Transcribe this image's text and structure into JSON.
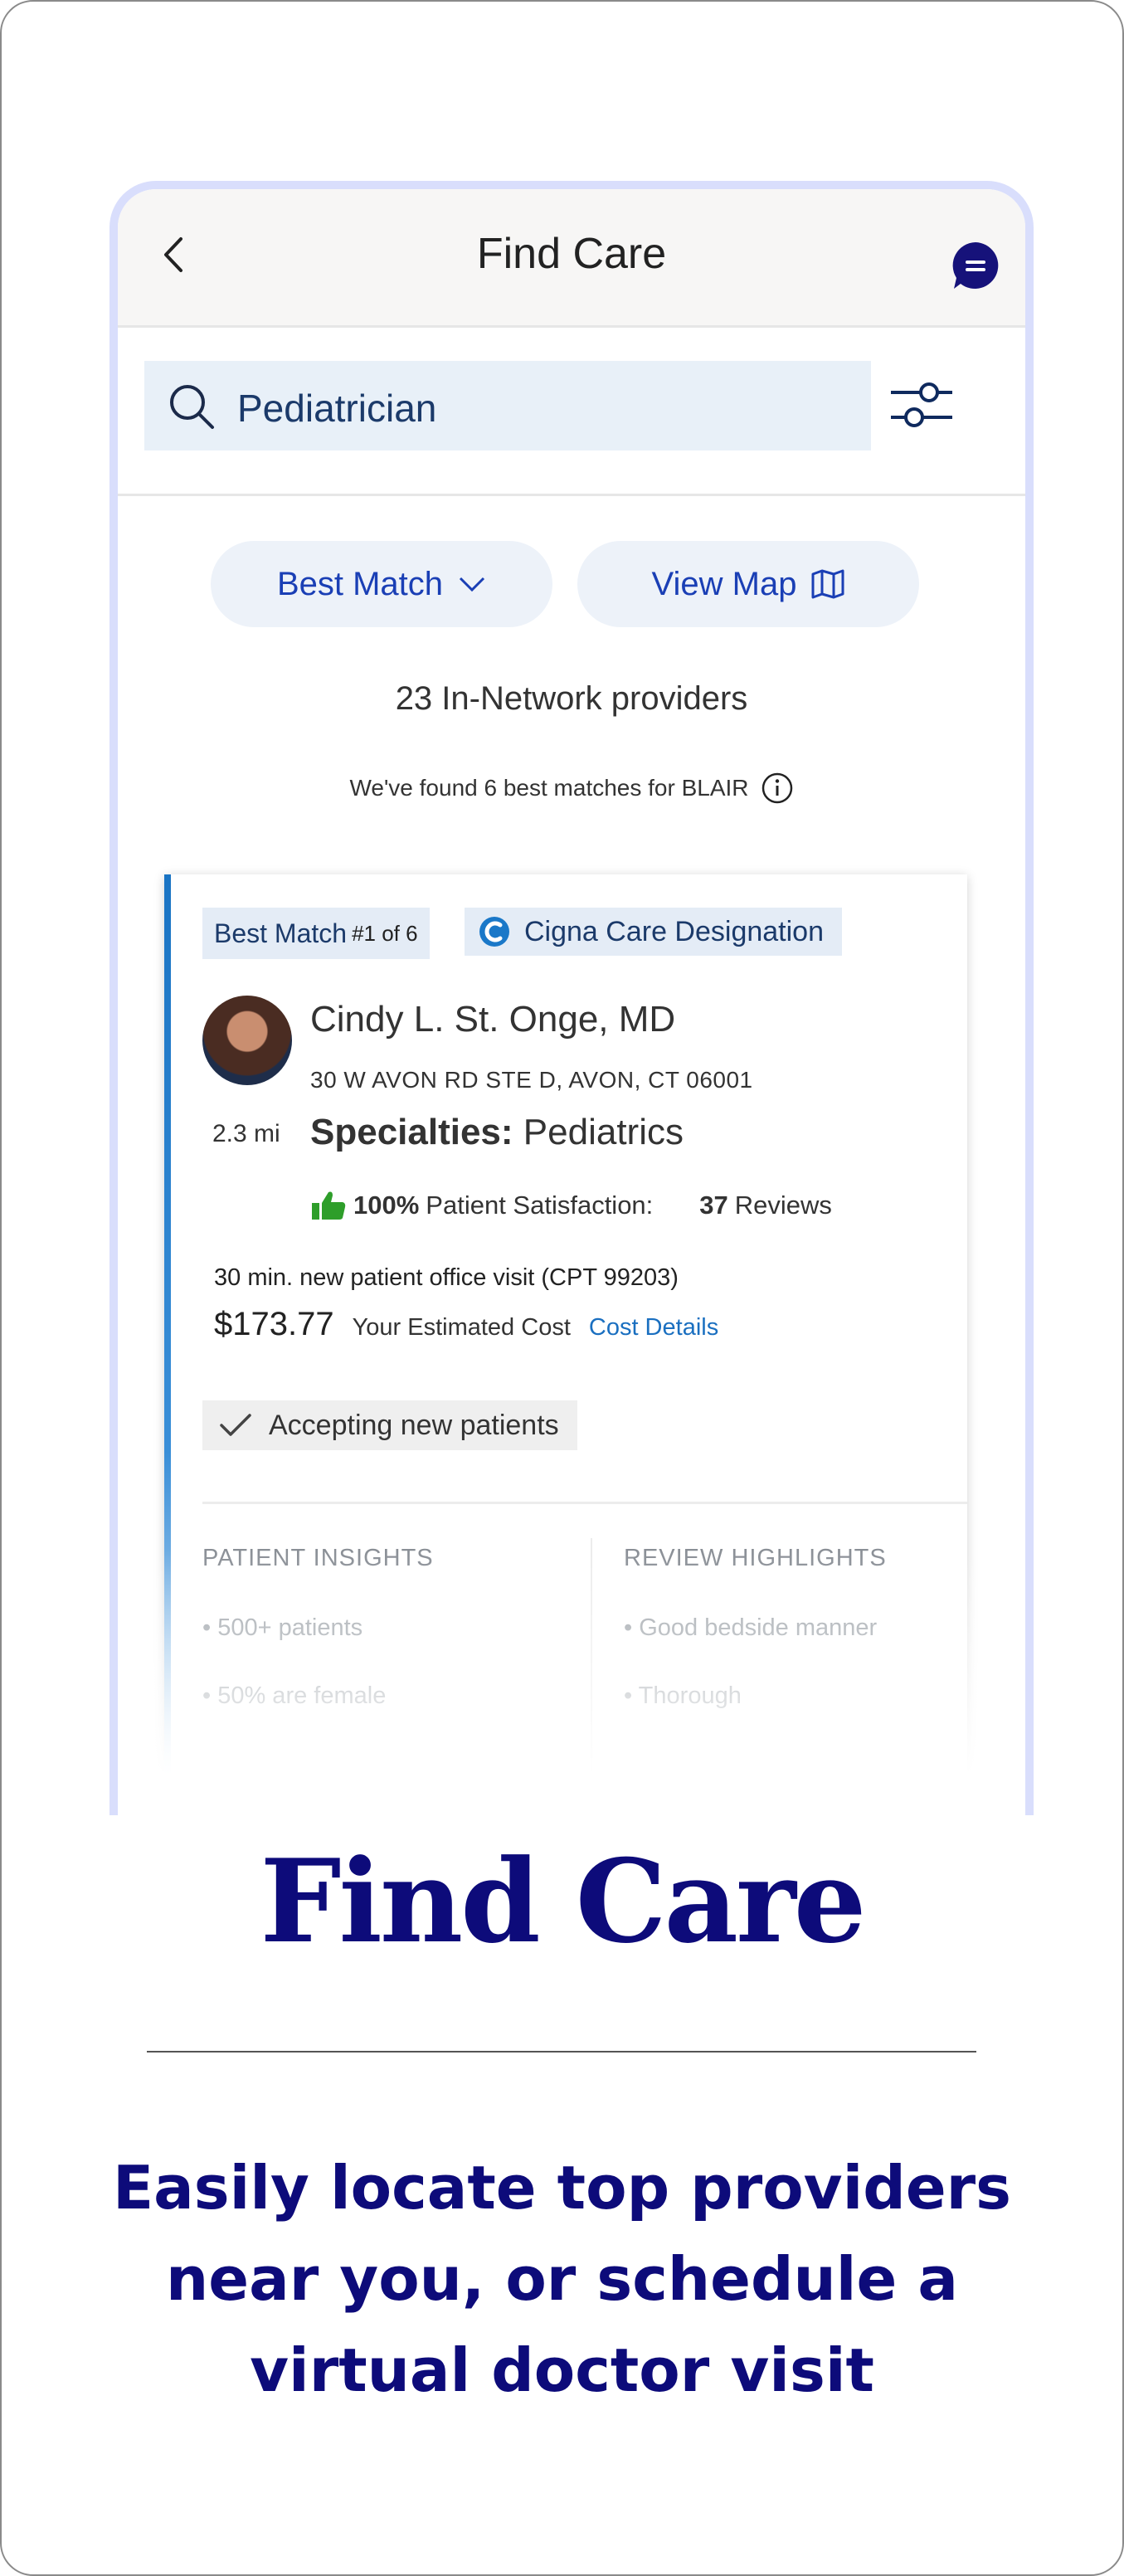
{
  "header": {
    "title": "Find Care"
  },
  "search": {
    "query": "Pediatrician"
  },
  "sort": {
    "best_match_label": "Best Match",
    "view_map_label": "View Map"
  },
  "results": {
    "count_text": "23 In-Network providers",
    "best_found_text": "We've found 6 best matches for BLAIR"
  },
  "card": {
    "best_match_label": "Best Match",
    "best_match_rank": "#1 of 6",
    "designation": "Cigna Care Designation",
    "name": "Cindy L. St. Onge, MD",
    "address": "30 W AVON RD STE D, AVON, CT 06001",
    "distance": "2.3 mi",
    "specialties_label": "Specialties:",
    "specialties_value": "Pediatrics",
    "satisfaction_pct": "100%",
    "satisfaction_label": "Patient Satisfaction:",
    "reviews_count": "37",
    "reviews_label": "Reviews",
    "visit_text": "30 min. new patient office visit (CPT 99203)",
    "cost": "$173.77",
    "cost_label": "Your Estimated Cost",
    "cost_link": "Cost Details",
    "accepting": "Accepting new patients",
    "insights_header": "PATIENT INSIGHTS",
    "insights": [
      "• 500+ patients",
      "• 50% are female"
    ],
    "reviews_header": "REVIEW HIGHLIGHTS",
    "highlights": [
      "• Good bedside manner",
      "• Thorough"
    ]
  },
  "promo": {
    "title": "Find Care",
    "tagline": "Easily locate top providers near you, or schedule a virtual doctor visit"
  },
  "colors": {
    "brand_navy": "#0d0b7a",
    "link_blue": "#1a3fb5",
    "phone_border": "#d9defc"
  }
}
